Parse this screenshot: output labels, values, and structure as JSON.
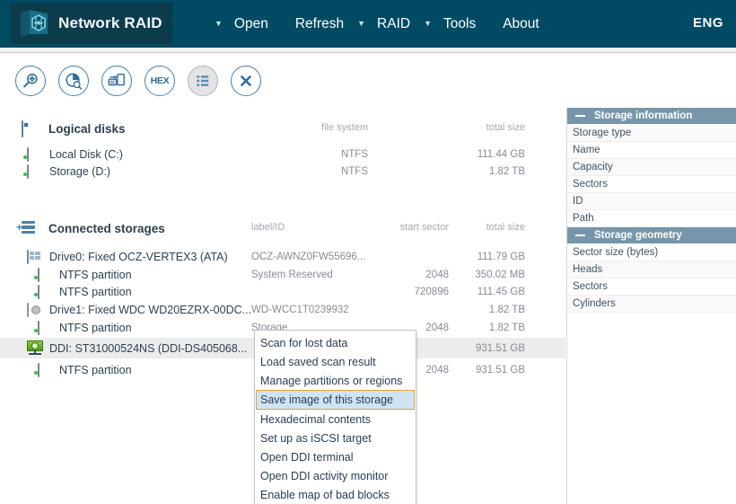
{
  "header": {
    "app_title": "Network RAID",
    "logo_icon": "network-raid-hexagon-logo",
    "menu": [
      {
        "label": "Open",
        "caret": true
      },
      {
        "label": "Refresh",
        "caret": false
      },
      {
        "label": "RAID",
        "caret": true
      },
      {
        "label": "Tools",
        "caret": true
      },
      {
        "label": "About",
        "caret": false
      }
    ],
    "language": "ENG",
    "bg_color": "#004a63"
  },
  "toolbar": {
    "buttons": [
      {
        "icon": "magnifier-scan-icon",
        "label": "",
        "active": false
      },
      {
        "icon": "pie-chart-search-icon",
        "label": "",
        "active": false
      },
      {
        "icon": "save-image-icon",
        "label": "",
        "active": false
      },
      {
        "icon": "hex-icon",
        "label": "HEX",
        "active": false
      },
      {
        "icon": "list-view-icon",
        "label": "",
        "active": true
      },
      {
        "icon": "close-x-icon",
        "label": "",
        "active": false
      }
    ],
    "accent_color": "#3f7fb0"
  },
  "logical_disks": {
    "section_title": "Logical disks",
    "section_icon": "monitor-icon",
    "columns": {
      "file_system": "file system",
      "total_size": "total size"
    },
    "rows": [
      {
        "icon": "drive-icon",
        "name": "Local Disk (C:)",
        "file_system": "NTFS",
        "total_size": "111.44 GB"
      },
      {
        "icon": "drive-icon",
        "name": "Storage (D:)",
        "file_system": "NTFS",
        "total_size": "1.82 TB"
      }
    ]
  },
  "connected_storages": {
    "section_title": "Connected storages",
    "section_icon": "storage-stack-icon",
    "columns": {
      "label_id": "label/ID",
      "start_sector": "start sector",
      "total_size": "total size"
    },
    "rows": [
      {
        "icon": "grid-disk-icon",
        "level": 1,
        "name": "Drive0: Fixed OCZ-VERTEX3 (ATA)",
        "label_id": "OCZ-AWNZ0FW55696...",
        "start_sector": "",
        "total_size": "111.79 GB",
        "selected": false
      },
      {
        "icon": "partition-icon",
        "level": 2,
        "name": "NTFS partition",
        "label_id": "System Reserved",
        "start_sector": "2048",
        "total_size": "350.02 MB",
        "selected": false
      },
      {
        "icon": "partition-icon",
        "level": 2,
        "name": "NTFS partition",
        "label_id": "",
        "start_sector": "720896",
        "total_size": "111.45 GB",
        "selected": false
      },
      {
        "icon": "platter-disk-icon",
        "level": 1,
        "name": "Drive1: Fixed WDC WD20EZRX-00DC...",
        "label_id": "WD-WCC1T0239932",
        "start_sector": "",
        "total_size": "1.82 TB",
        "selected": false
      },
      {
        "icon": "partition-icon",
        "level": 2,
        "name": "NTFS partition",
        "label_id": "Storage",
        "start_sector": "2048",
        "total_size": "1.82 TB",
        "selected": false
      },
      {
        "icon": "ddi-network-icon",
        "level": 1,
        "name": "DDI: ST31000524NS (DDI-DS405068...",
        "label_id": "",
        "start_sector": "",
        "total_size": "931.51 GB",
        "selected": true
      },
      {
        "icon": "partition-icon",
        "level": 2,
        "name": "NTFS partition",
        "label_id": "",
        "start_sector": "2048",
        "total_size": "931.51 GB",
        "selected": false
      }
    ]
  },
  "context_menu": {
    "items": [
      {
        "label": "Scan for lost data",
        "highlighted": false
      },
      {
        "label": "Load saved scan result",
        "highlighted": false
      },
      {
        "label": "Manage partitions or regions",
        "highlighted": false
      },
      {
        "label": "Save image of this storage",
        "highlighted": true
      },
      {
        "label": "Hexadecimal contents",
        "highlighted": false
      },
      {
        "label": "Set up as iSCSI target",
        "highlighted": false
      },
      {
        "label": "Open DDI terminal",
        "highlighted": false
      },
      {
        "label": "Open DDI activity monitor",
        "highlighted": false
      },
      {
        "label": "Enable map of bad blocks",
        "highlighted": false
      }
    ],
    "highlight_bg": "#cfe3f5",
    "highlight_border": "#e0a42c"
  },
  "sidebar": {
    "panels": [
      {
        "title": "Storage information",
        "collapse_icon": "minus-icon",
        "properties": [
          "Storage type",
          "Name",
          "Capacity",
          "Sectors",
          "ID",
          "Path"
        ]
      },
      {
        "title": "Storage geometry",
        "collapse_icon": "minus-icon",
        "properties": [
          "Sector size (bytes)",
          "Heads",
          "Sectors",
          "Cylinders"
        ]
      }
    ],
    "header_color": "#7796aa"
  }
}
